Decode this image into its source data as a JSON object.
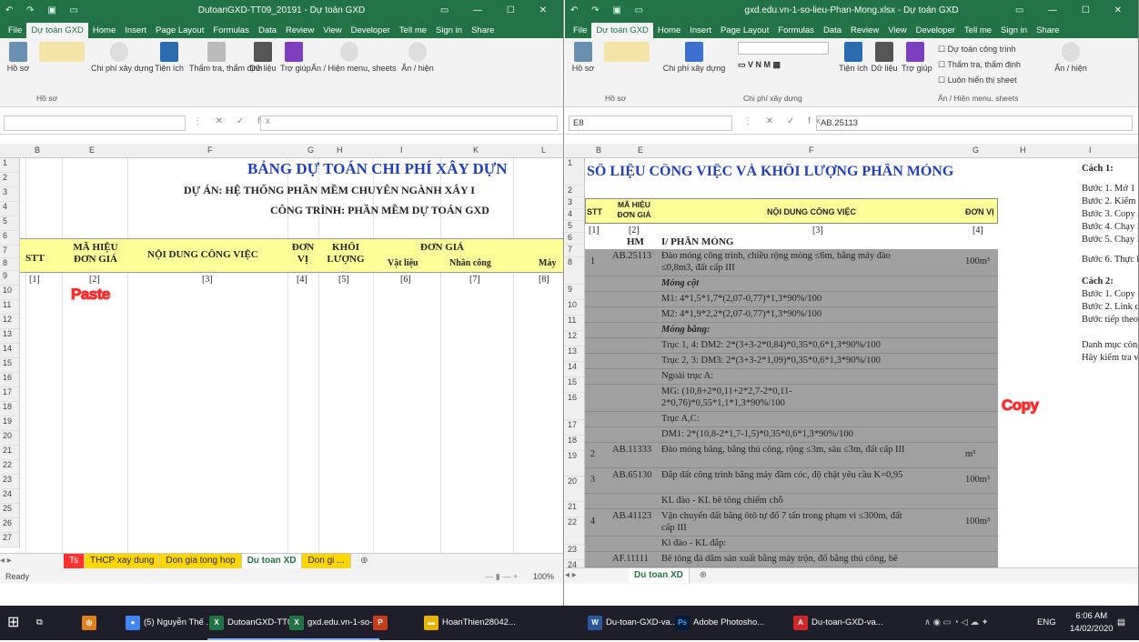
{
  "window_left": {
    "title": "DutoanGXD-TT09_20191 - Dự toán GXD",
    "tabs": [
      "File",
      "Dự toán GXD",
      "Home",
      "Insert",
      "Page Layout",
      "Formulas",
      "Data",
      "Review",
      "View",
      "Developer",
      "Tell me",
      "Sign in",
      "Share"
    ],
    "ribbon": [
      "Hồ sơ",
      "Chi phí xây dựng",
      "Tiện ích",
      "Thẩm tra, thẩm định",
      "Dữ liệu",
      "Trợ giúp",
      "Ẩn / Hiện menu, sheets",
      "Ẩn / hiện"
    ],
    "ribbon_group": "Hồ sơ",
    "name_box": "",
    "sheet_title": "BẢNG DỰ TOÁN CHI PHÍ XÂY DỰN",
    "project": "DỰ ÁN: HỆ THỐNG PHẦN MỀM CHUYÊN NGÀNH XÂY I",
    "work": "CÔNG TRÌNH: PHẦN MỀM DỰ TOÁN GXD",
    "col_headers": [
      "B",
      "E",
      "F",
      "G",
      "H",
      "I",
      "K",
      "L"
    ],
    "rows": [
      "1",
      "2",
      "3",
      "4",
      "5",
      "6",
      "7",
      "8",
      "9",
      "10",
      "11",
      "12",
      "13",
      "14",
      "15",
      "16",
      "17",
      "18",
      "19",
      "20",
      "21",
      "22",
      "23",
      "24",
      "25",
      "26",
      "27"
    ],
    "table_head": {
      "stt": "STT",
      "ma": "MÃ HIỆU ĐƠN GIÁ",
      "nd": "NỘI DUNG CÔNG VIỆC",
      "dv": "ĐƠN VỊ",
      "kl": "KHỐI LƯỢNG",
      "dg": "ĐƠN GIÁ",
      "vl": "Vật liệu",
      "nc": "Nhân công",
      "may": "Máy"
    },
    "idx": [
      "[1]",
      "[2]",
      "[3]",
      "[4]",
      "[5]",
      "[6]",
      "[7]",
      "[8]"
    ],
    "paste_label": "Paste",
    "sheets": [
      "Ts",
      "THCP xay dung",
      "Don gia tong hop",
      "Du toan XD",
      "Don gi ..."
    ],
    "status_ready": "Ready",
    "zoom": "100%"
  },
  "window_right": {
    "title": "gxd.edu.vn-1-so-lieu-Phan-Mong.xlsx - Dự toán GXD",
    "tabs": [
      "File",
      "Dự toán GXD",
      "Home",
      "Insert",
      "Page Layout",
      "Formulas",
      "Data",
      "Review",
      "View",
      "Developer",
      "Tell me",
      "Sign in",
      "Share"
    ],
    "ribbon": [
      "Hồ sơ",
      "Chi phí xây dựng",
      "Tiện ích",
      "Dữ liệu",
      "Trợ giúp",
      "Ẩn / hiện"
    ],
    "checks": [
      "Dự toán công trình",
      "Thẩm tra, thẩm định",
      "Luôn hiển thị sheet"
    ],
    "labels": [
      "Hồ sơ",
      "Chi phí xây dựng",
      "Ẩn / Hiện menu, sheets"
    ],
    "name_box": "E8",
    "formula": "AB.25113",
    "col_headers": [
      "B",
      "E",
      "F",
      "G",
      "H",
      "I"
    ],
    "sheet_title": "SỐ LIỆU CÔNG VIỆC VÀ KHỐI LƯỢNG PHẦN MÓNG",
    "head": {
      "stt": "STT",
      "ma": "MÃ HIỆU ĐƠN GIÁ",
      "nd": "NỘI DUNG CÔNG VIỆC",
      "dv": "ĐƠN VỊ"
    },
    "idx": [
      "[1]",
      "[2]",
      "[3]",
      "[4]"
    ],
    "hm": "HM",
    "phan_mong": "I/ PHẦN MÓNG",
    "rows": [
      {
        "r": "8",
        "stt": "1",
        "ma": "AB.25113",
        "nd": "Đào móng công trình, chiều rộng móng ≤6m, bằng máy đào",
        "nd2": "≤0,8m3, đất cấp III",
        "dv": "100m³"
      },
      {
        "r": "9",
        "nd": "Móng cột"
      },
      {
        "r": "10",
        "nd": "M1: 4*1,5*1,7*(2,07-0,77)*1,3*90%/100"
      },
      {
        "r": "11",
        "nd": "M2: 4*1,9*2,2*(2,07-0,77)*1,3*90%/100"
      },
      {
        "r": "12",
        "nd": "Móng băng:"
      },
      {
        "r": "13",
        "nd": "Trục 1, 4: DM2:  2*(3+3-2*0,84)*0,35*0,6*1,3*90%/100"
      },
      {
        "r": "14",
        "nd": "Trục 2, 3:  DM3: 2*(3+3-2*1,09)*0,35*0,6*1,3*90%/100"
      },
      {
        "r": "15",
        "nd": "Ngoài trục A:"
      },
      {
        "r": "16",
        "nd": "MG: (10,8+2*0,11+2*2,7-2*0,11-",
        "nd2": "2*0,76)*0,55*1,1*1,3*90%/100"
      },
      {
        "r": "17",
        "nd": "Trục A,C:"
      },
      {
        "r": "18",
        "nd": "DM1: 2*(10,8-2*1,7-1,5)*0,35*0,6*1,3*90%/100"
      },
      {
        "r": "19",
        "stt": "2",
        "ma": "AB.11333",
        "nd": "Đào móng băng, bằng thủ công, rộng ≤3m, sâu ≤3m, đất cấp III",
        "dv": "m³"
      },
      {
        "r": "20",
        "stt": "3",
        "ma": "AB.65130",
        "nd": "Đắp đất công trình bằng máy đầm cóc, độ chặt yêu cầu K=0,95",
        "dv": "100m³"
      },
      {
        "r": "21",
        "nd": "KL đào - KL bê tông chiếm chỗ"
      },
      {
        "r": "22",
        "stt": "4",
        "ma": "AB.41123",
        "nd": "Vận chuyển đất bằng ôtô tự đổ 7 tấn trong phạm vi ≤300m, đất",
        "nd2": "cấp III",
        "dv": "100m³"
      },
      {
        "r": "23",
        "nd": "Kl đào - KL đắp:"
      },
      {
        "r": "24",
        "ma": "AF.11111",
        "nd": "Bê tông đá dăm sản xuất bằng máy trộn, đổ bằng thủ công, bê"
      }
    ],
    "side": [
      "Cách 1:",
      "Bước 1. Mở 1 fi",
      "Bước 2. Kiểm tr",
      "Bước 3. Copy / ",
      "Bước 4. Chạy lệ",
      "Bước 5. Chạy lệ",
      "Bước 6. Thực hi",
      "Cách 2:",
      "Bước 1. Copy ca",
      "Bước 2. Link dữ",
      "Bước tiếp theo:",
      "Danh mục công v",
      "Hãy kiểm tra và"
    ],
    "copy_label": "Copy",
    "sheet_tab": "Du toan XD"
  },
  "taskbar": {
    "items": [
      "(5) Nguyễn Thế ...",
      "DutoanGXD-TT0...",
      "gxd.edu.vn-1-so-...",
      "HoanThien28042...",
      "Du-toan-GXD-va...",
      "Adobe Photosho...",
      "Du-toan-GXD-va..."
    ],
    "lang": "ENG",
    "time": "6:06 AM",
    "date": "14/02/2020"
  }
}
